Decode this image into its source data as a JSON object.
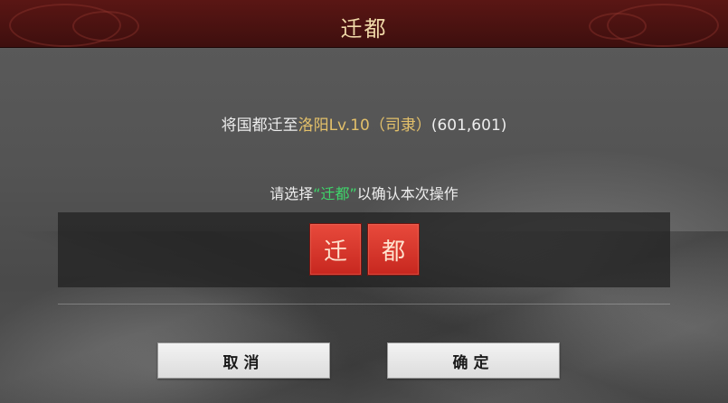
{
  "dialog": {
    "title": "迁都",
    "info": {
      "prefix": "将国都迁至",
      "city": "洛阳Lv.10（司隶）",
      "coords": "(601,601)"
    },
    "prompt": {
      "before": "请选择",
      "keyword": "“迁都”",
      "after": "以确认本次操作"
    },
    "tiles": [
      "迁",
      "都"
    ],
    "buttons": {
      "cancel": "取消",
      "confirm": "确定"
    }
  },
  "colors": {
    "title_bar": "#4a1211",
    "title_text": "#f0d9a8",
    "gold_text": "#e3c06a",
    "green_text": "#3fd66b",
    "tile_red": "#d9352a"
  }
}
